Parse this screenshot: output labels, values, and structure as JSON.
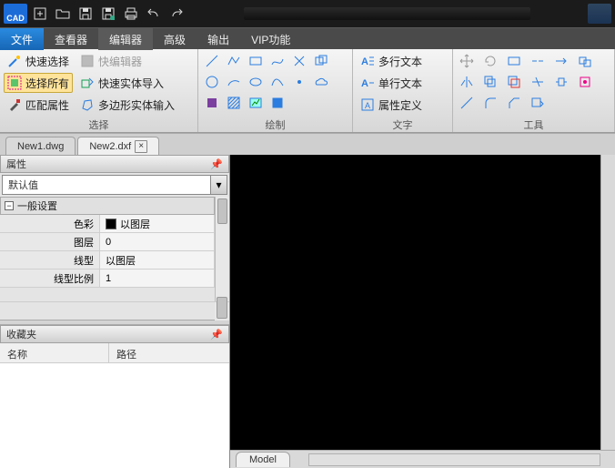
{
  "app": {
    "logo_text": "CAD"
  },
  "menu": {
    "items": [
      "文件",
      "查看器",
      "编辑器",
      "高级",
      "输出",
      "VIP功能"
    ],
    "active_index": 2
  },
  "ribbon": {
    "select": {
      "quick_select": "快速选择",
      "select_all": "选择所有",
      "match_prop": "匹配属性",
      "quick_editor": "快编辑器",
      "quick_entity_import": "快速实体导入",
      "poly_entity_input": "多边形实体输入",
      "label": "选择"
    },
    "draw": {
      "label": "绘制"
    },
    "text": {
      "multiline": "多行文本",
      "singleline": "单行文本",
      "attrdef": "属性定义",
      "label": "文字"
    },
    "tools": {
      "label": "工具"
    }
  },
  "doctabs": {
    "tabs": [
      {
        "name": "New1.dwg",
        "active": false,
        "closeable": false
      },
      {
        "name": "New2.dxf",
        "active": true,
        "closeable": true
      }
    ]
  },
  "panels": {
    "properties": {
      "title": "属性",
      "default_label": "默认值",
      "section": "一般设置",
      "rows": [
        {
          "k": "色彩",
          "v": "以图层",
          "swatch": true
        },
        {
          "k": "图层",
          "v": "0"
        },
        {
          "k": "线型",
          "v": "以图层"
        },
        {
          "k": "线型比例",
          "v": "1"
        }
      ]
    },
    "favorites": {
      "title": "收藏夹",
      "col_name": "名称",
      "col_path": "路径"
    }
  },
  "status": {
    "model_tab": "Model"
  }
}
